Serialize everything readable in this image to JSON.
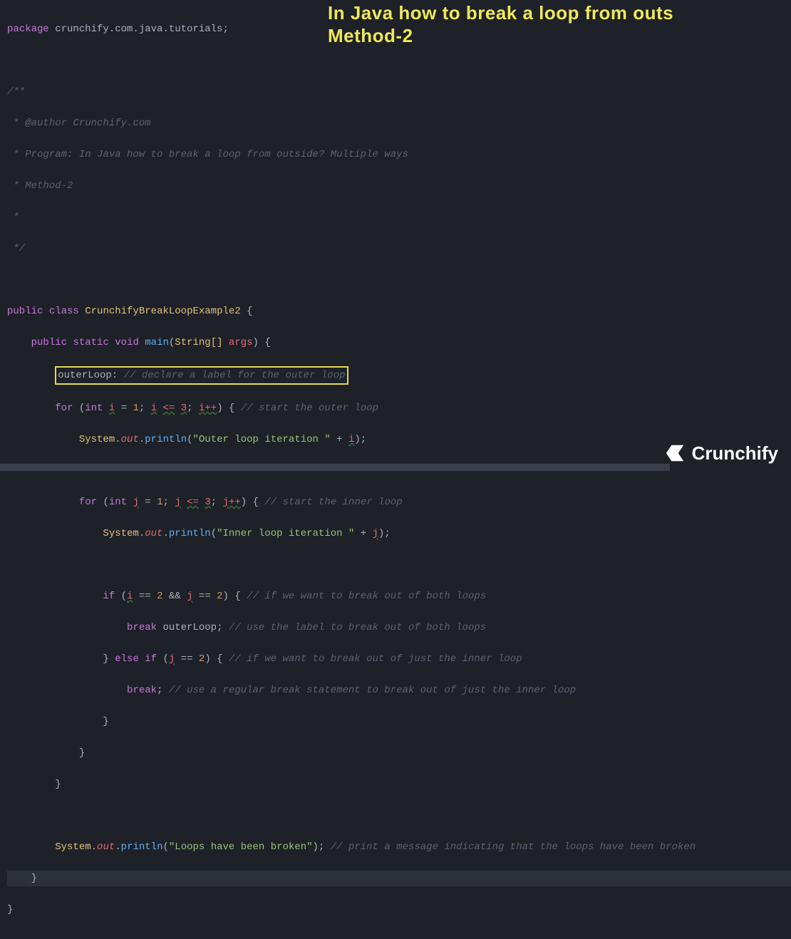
{
  "title_overlay": {
    "line1": "In Java how to break a loop from outs",
    "line2": "Method-2"
  },
  "code": {
    "package_kw": "package",
    "package_path": "crunchify.com.java.tutorials",
    "doc_open": "/**",
    "doc_author_tag": "@author",
    "doc_author_val": "Crunchify.com",
    "doc_program": " * Program: In Java how to break a loop from outside? Multiple ways",
    "doc_method": " * Method-2",
    "doc_star": " *",
    "doc_close": " */",
    "public": "public",
    "class_kw": "class",
    "class_name": "CrunchifyBreakLoopExample2",
    "static": "static",
    "void": "void",
    "main": "main",
    "string_arr": "String[]",
    "args": "args",
    "outerLoop_label": "outerLoop:",
    "outerLoop_comment": "// declare a label for the outer loop",
    "for": "for",
    "int": "int",
    "i": "i",
    "j": "j",
    "one": "1",
    "two": "2",
    "three": "3",
    "le": "<=",
    "inc_i": "i++",
    "inc_j": "j++",
    "outer_for_comment": "// start the outer loop",
    "System": "System",
    "out": "out",
    "println": "println",
    "str_outer": "\"Outer loop iteration \"",
    "str_inner": "\"Inner loop iteration \"",
    "inner_for_comment": "// start the inner loop",
    "if": "if",
    "eqeq": "==",
    "andand": "&&",
    "if_both_comment": "// if we want to break out of both loops",
    "break": "break",
    "outerLoop_ref": "outerLoop",
    "break_both_comment": "// use the label to break out of both loops",
    "else": "else",
    "if_inner_comment": "// if we want to break out of just the inner loop",
    "break_inner_comment": "// use a regular break statement to break out of just the inner loop",
    "str_done": "\"Loops have been broken\"",
    "done_comment": "// print a message indicating that the loops have been broken"
  },
  "logo_text": "Crunchify"
}
